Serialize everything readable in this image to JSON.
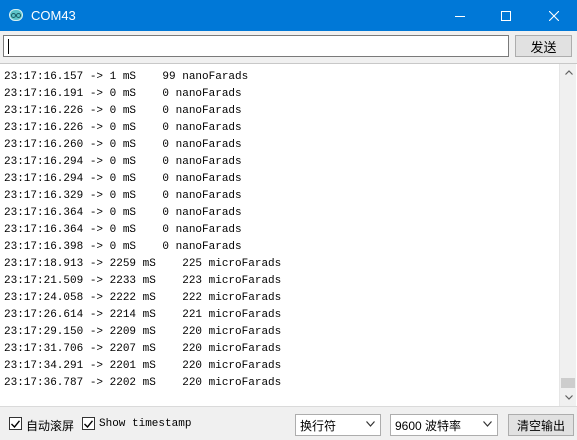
{
  "window": {
    "title": "COM43",
    "icon": "arduino-icon"
  },
  "input": {
    "value": "",
    "send_label": "发送"
  },
  "serial_output": [
    "23:17:16.157 -> 1 mS    99 nanoFarads",
    "23:17:16.191 -> 0 mS    0 nanoFarads",
    "23:17:16.226 -> 0 mS    0 nanoFarads",
    "23:17:16.226 -> 0 mS    0 nanoFarads",
    "23:17:16.260 -> 0 mS    0 nanoFarads",
    "23:17:16.294 -> 0 mS    0 nanoFarads",
    "23:17:16.294 -> 0 mS    0 nanoFarads",
    "23:17:16.329 -> 0 mS    0 nanoFarads",
    "23:17:16.364 -> 0 mS    0 nanoFarads",
    "23:17:16.364 -> 0 mS    0 nanoFarads",
    "23:17:16.398 -> 0 mS    0 nanoFarads",
    "23:17:18.913 -> 2259 mS    225 microFarads",
    "23:17:21.509 -> 2233 mS    223 microFarads",
    "23:17:24.058 -> 2222 mS    222 microFarads",
    "23:17:26.614 -> 2214 mS    221 microFarads",
    "23:17:29.150 -> 2209 mS    220 microFarads",
    "23:17:31.706 -> 2207 mS    220 microFarads",
    "23:17:34.291 -> 2201 mS    220 microFarads",
    "23:17:36.787 -> 2202 mS    220 microFarads"
  ],
  "footer": {
    "autoscroll_label": "自动滚屏",
    "autoscroll_checked": true,
    "timestamp_label": "Show timestamp",
    "timestamp_checked": true,
    "line_ending": "换行符",
    "baud_rate": "9600 波特率",
    "clear_label": "清空输出"
  },
  "colors": {
    "titlebar": "#0078d7",
    "background": "#f0f0f0"
  }
}
